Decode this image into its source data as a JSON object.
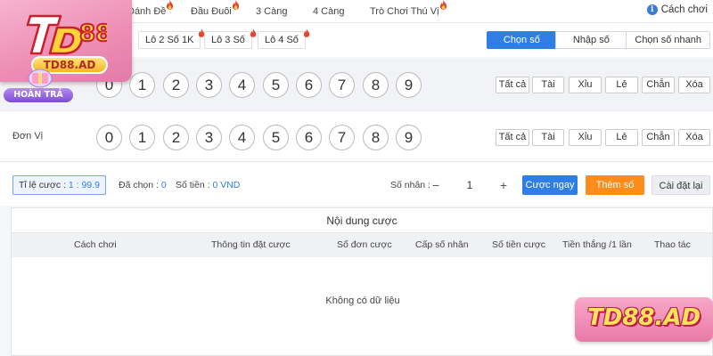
{
  "top_tabs": [
    {
      "label": "Ba",
      "hot": false
    },
    {
      "label": "Đánh Đề",
      "hot": true
    },
    {
      "label": "Đầu Đuôi",
      "hot": true
    },
    {
      "label": "3 Càng",
      "hot": false
    },
    {
      "label": "4 Càng",
      "hot": false
    },
    {
      "label": "Trò Chơi Thú Vị",
      "hot": true
    }
  ],
  "how_to_play": "Cách chơi",
  "sub_tabs": [
    "Lô 2 Số 1K",
    "Lô 3 Số",
    "Lô 4 Số"
  ],
  "modes": {
    "pick": "Chọn số",
    "input": "Nhập số",
    "quick": "Chọn số nhanh"
  },
  "rows": [
    {
      "label": "",
      "balls": [
        "0",
        "1",
        "2",
        "3",
        "4",
        "5",
        "6",
        "7",
        "8",
        "9"
      ]
    },
    {
      "label": "Đơn Vị",
      "balls": [
        "0",
        "1",
        "2",
        "3",
        "4",
        "5",
        "6",
        "7",
        "8",
        "9"
      ]
    }
  ],
  "quick_select": [
    "Tất cả",
    "Tài",
    "Xỉu",
    "Lẻ",
    "Chẵn",
    "Xóa"
  ],
  "info": {
    "ratio_label": "Tỉ lệ cược : ",
    "ratio_value": "1 : 99.9",
    "selected_label": "Đã chọn : ",
    "selected_value": "0",
    "amount_label": "Số tiền : ",
    "amount_value": "0 VND",
    "multiplier_label": "Số nhân :",
    "multiplier_value": "1",
    "minus": "−",
    "plus": "+"
  },
  "buttons": {
    "bet_now": "Cược ngay",
    "add_number": "Thêm số",
    "reset": "Cài đặt lại"
  },
  "table": {
    "title": "Nội dung cược",
    "headers": [
      "Cách chơi",
      "Thông tin đặt cược",
      "Số đơn cược",
      "Cấp số nhân",
      "Số tiền cược",
      "Tiền thắng /1 lần",
      "Thao tác"
    ],
    "empty": "Không có dữ liệu"
  },
  "logo": {
    "brand": "TD88.AD",
    "refund": "HOÀN TRẢ"
  },
  "watermark": "TD88.AD",
  "colors": {
    "primary": "#2f7ee6",
    "orange": "#ff8c1a",
    "hot": "#e8452c"
  }
}
